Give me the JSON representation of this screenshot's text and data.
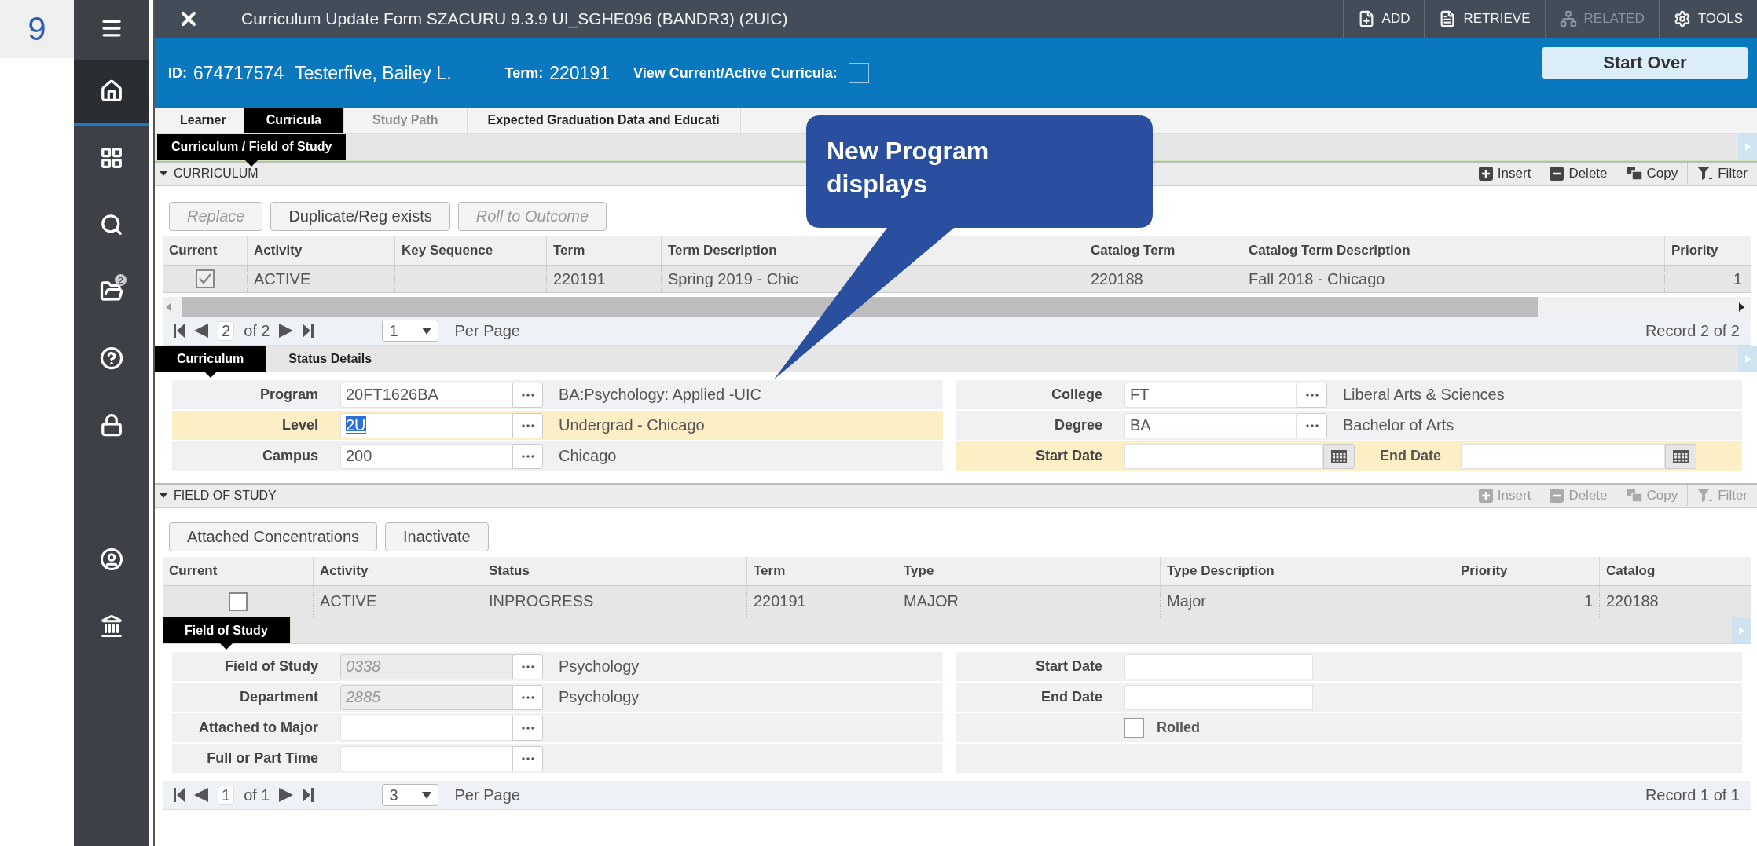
{
  "step_number": "9",
  "sidebar": {
    "top_items": [
      {
        "kind": "menu",
        "selected": false
      },
      {
        "kind": "home",
        "selected": true
      },
      {
        "kind": "grid",
        "selected": false
      },
      {
        "kind": "search",
        "selected": false
      },
      {
        "kind": "folder",
        "selected": false,
        "badge": "2"
      },
      {
        "kind": "help",
        "selected": false
      },
      {
        "kind": "lock",
        "selected": false
      }
    ],
    "bottom_items": [
      {
        "kind": "user",
        "selected": false
      },
      {
        "kind": "bank",
        "selected": false
      }
    ]
  },
  "title_bar": {
    "title": "Curriculum Update Form SZACURU 9.3.9 UI_SGHE096 (BANDR3) (2UIC)",
    "actions": [
      {
        "kind": "add",
        "label": "ADD",
        "disabled": false
      },
      {
        "kind": "retrieve",
        "label": "RETRIEVE",
        "disabled": false
      },
      {
        "kind": "related",
        "label": "RELATED",
        "disabled": true
      },
      {
        "kind": "tools",
        "label": "TOOLS",
        "disabled": false
      }
    ]
  },
  "key_block": {
    "id_label": "ID:",
    "id": "674717574",
    "name": "Testerfive, Bailey L.",
    "term_label": "Term:",
    "term": "220191",
    "view_current_label": "View Current/Active Curricula:",
    "view_current_checked": false,
    "start_over": "Start Over"
  },
  "tabs": [
    {
      "label": "Learner",
      "selected": false,
      "disabled": false
    },
    {
      "label": "Curricula",
      "selected": true,
      "disabled": false
    },
    {
      "label": "Study Path",
      "selected": false,
      "disabled": true
    },
    {
      "label": "Expected Graduation Data and Educati",
      "selected": false,
      "disabled": false
    }
  ],
  "section_tab": {
    "label": "Curriculum / Field of Study"
  },
  "curriculum": {
    "title": "CURRICULUM",
    "expanded": true,
    "toolbar": [
      {
        "kind": "insert",
        "label": "Insert",
        "disabled": false
      },
      {
        "kind": "delete",
        "label": "Delete",
        "disabled": false
      },
      {
        "kind": "copy",
        "label": "Copy",
        "disabled": false
      },
      {
        "kind": "filter",
        "label": "Filter",
        "disabled": false
      }
    ],
    "buttons": [
      {
        "label": "Replace",
        "disabled": true
      },
      {
        "label": "Duplicate/Reg exists",
        "disabled": false
      },
      {
        "label": "Roll to Outcome",
        "disabled": true
      }
    ],
    "columns": [
      "Current",
      "Activity",
      "Key Sequence",
      "Term",
      "Term Description",
      "Catalog Term",
      "Catalog Term Description",
      "Priority"
    ],
    "rows": [
      {
        "current": true,
        "activity": "ACTIVE",
        "term": "220191",
        "term_description": "Spring 2019 - Chic",
        "catalog_term": "220188",
        "catalog_term_description": "Fall 2018 - Chicago",
        "priority": "1"
      }
    ],
    "pager": {
      "page": "2",
      "of": "of 2",
      "per_page": "1",
      "per_page_label": "Per Page",
      "record": "Record 2 of 2"
    },
    "subtabs": [
      {
        "label": "Curriculum",
        "selected": true
      },
      {
        "label": "Status Details",
        "selected": false
      }
    ],
    "form_left": [
      {
        "label": "Program",
        "value": "20FT1626BA",
        "description": "BA:Psychology: Applied  -UIC",
        "highlighted": false,
        "focused": false
      },
      {
        "label": "Level",
        "value": "2U",
        "description": "Undergrad - Chicago",
        "highlighted": true,
        "focused": true
      },
      {
        "label": "Campus",
        "value": "200",
        "description": "Chicago",
        "highlighted": false,
        "focused": false
      }
    ],
    "form_right": [
      {
        "kind": "lookup",
        "label": "College",
        "value": "FT",
        "description": "Liberal Arts & Sciences",
        "highlighted": false
      },
      {
        "kind": "lookup",
        "label": "Degree",
        "value": "BA",
        "description": "Bachelor of Arts",
        "highlighted": false
      },
      {
        "kind": "date_range",
        "label": "Start Date",
        "label_2": "End Date",
        "highlighted": true
      }
    ]
  },
  "field_of_study": {
    "title": "FIELD OF STUDY",
    "expanded": true,
    "toolbar": [
      {
        "kind": "insert",
        "label": "Insert",
        "disabled": true
      },
      {
        "kind": "delete",
        "label": "Delete",
        "disabled": true
      },
      {
        "kind": "copy",
        "label": "Copy",
        "disabled": true
      },
      {
        "kind": "filter",
        "label": "Filter",
        "disabled": true
      }
    ],
    "buttons": [
      {
        "label": "Attached Concentrations",
        "disabled": false
      },
      {
        "label": "Inactivate",
        "disabled": false
      }
    ],
    "columns": [
      "Current",
      "Activity",
      "Status",
      "Term",
      "Type",
      "Type Description",
      "Priority",
      "Catalog"
    ],
    "rows": [
      {
        "current": false,
        "activity": "ACTIVE",
        "status": "INPROGRESS",
        "term": "220191",
        "type": "MAJOR",
        "type_description": "Major",
        "priority": "1",
        "catalog": "220188"
      }
    ],
    "subtabs": [
      {
        "label": "Field of Study",
        "selected": true
      }
    ],
    "form_left": [
      {
        "label": "Field of Study",
        "value": "0338",
        "description": "Psychology",
        "disabled": true
      },
      {
        "label": "Department",
        "value": "2885",
        "description": "Psychology",
        "disabled": true
      },
      {
        "label": "Attached to Major",
        "disabled": false
      },
      {
        "label": "Full or Part Time",
        "disabled": false
      }
    ],
    "form_right": [
      {
        "kind": "date",
        "label": "Start Date"
      },
      {
        "kind": "date",
        "label": "End Date"
      },
      {
        "kind": "checkbox",
        "label": "Rolled",
        "checked": false
      },
      {
        "kind": "empty"
      }
    ],
    "pager": {
      "page": "1",
      "of": "of 1",
      "per_page": "3",
      "per_page_label": "Per Page",
      "record": "Record 1 of 1"
    }
  },
  "callout": {
    "text": "New Program displays"
  }
}
